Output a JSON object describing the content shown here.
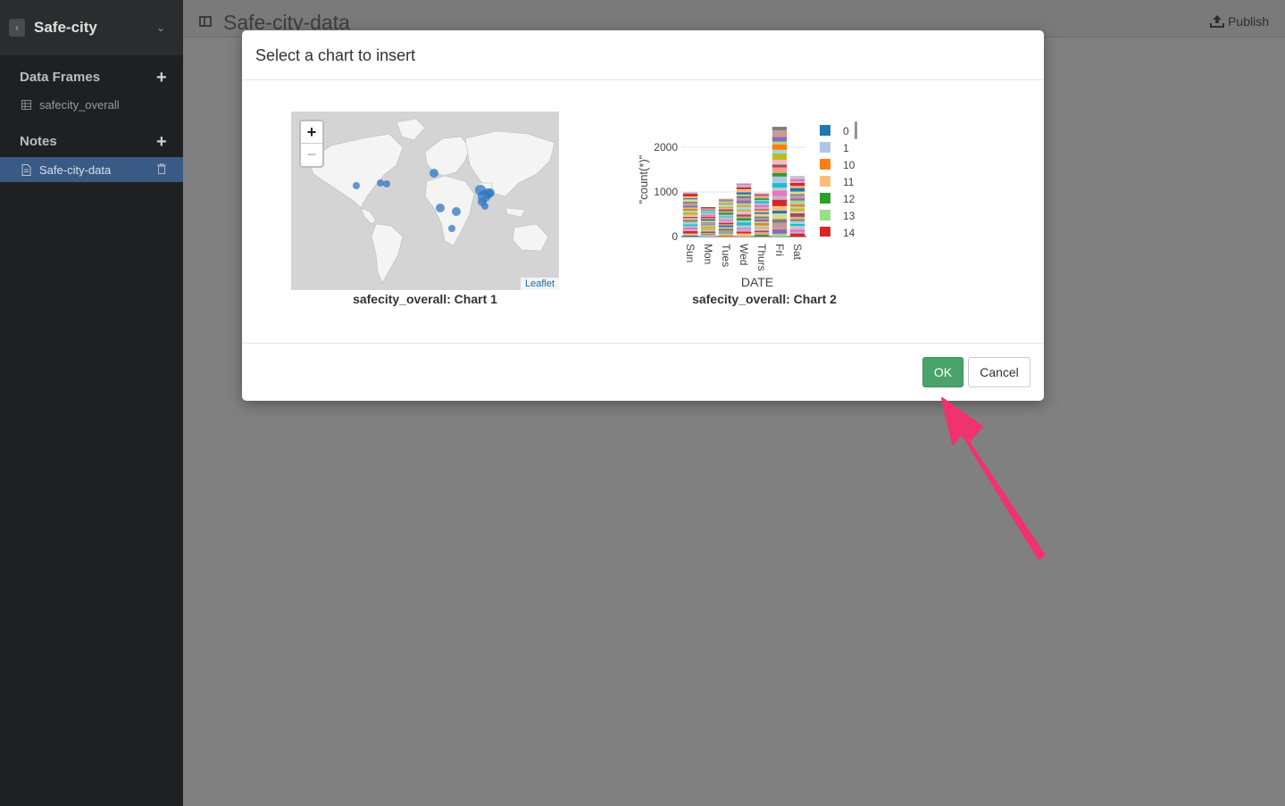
{
  "sidebar": {
    "project_name": "Safe-city",
    "sections": {
      "data_frames": {
        "label": "Data Frames",
        "items": [
          "safecity_overall"
        ]
      },
      "notes": {
        "label": "Notes",
        "items": [
          "Safe-city-data"
        ]
      }
    }
  },
  "header": {
    "doc_title": "Safe-city-data",
    "publish_label": "Publish"
  },
  "modal": {
    "title": "Select a chart to insert",
    "chart1_caption": "safecity_overall: Chart 1",
    "chart2_caption": "safecity_overall: Chart 2",
    "zoom_in": "+",
    "zoom_out": "−",
    "attribution": "Leaflet",
    "ok_label": "OK",
    "cancel_label": "Cancel"
  },
  "colors": {
    "ok_green": "#4aa36a",
    "sidebar_active": "#3a5a86",
    "annotation_arrow": "#f0326f"
  },
  "chart_data": {
    "type": "bar",
    "stacked": true,
    "categories": [
      "Sun",
      "Mon",
      "Tues",
      "Wed",
      "Thurs",
      "Fri",
      "Sat"
    ],
    "xlabel": "DATE",
    "ylabel": "\"count(*)\"",
    "ylim": [
      0,
      2500
    ],
    "yticks": [
      0,
      1000,
      2000
    ],
    "totals": [
      1000,
      660,
      860,
      1190,
      980,
      2480,
      1360
    ],
    "legend": [
      "0",
      "1",
      "10",
      "11",
      "12",
      "13",
      "14"
    ],
    "legend_colors": [
      "#1f77b4",
      "#aec7e8",
      "#ff7f0e",
      "#ffbb78",
      "#2ca02c",
      "#98df8a",
      "#d62728"
    ],
    "legend_position": "right"
  }
}
